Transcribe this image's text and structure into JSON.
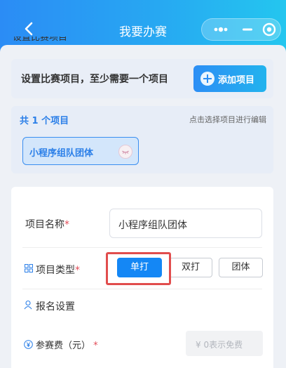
{
  "nav": {
    "title": "我要办赛"
  },
  "peek_text": "设置比赛项目",
  "add_section": {
    "hint": "设置比赛项目，至少需要一个项目",
    "add_button": "添加项目"
  },
  "project_list": {
    "count_label": "共 1 个项目",
    "tip": "点击选择项目进行编辑",
    "items": [
      "小程序组队团体"
    ]
  },
  "form": {
    "name_label": "项目名称",
    "name_value": "小程序组队团体",
    "type_label": "项目类型",
    "type_options": [
      "单打",
      "双打",
      "团体"
    ],
    "type_selected": "单打",
    "signup_label": "报名设置",
    "fee_label": "参赛费（元）",
    "fee_placeholder": "¥ 0表示免费",
    "required_mark": "*"
  },
  "colors": {
    "nav_start": "#2b8cf5",
    "nav_end": "#24c6ef",
    "accent": "#1487f5",
    "required": "#e34d59",
    "highlight": "#e14d4d"
  },
  "icons": [
    "back-arrow-icon",
    "more-dots-icon",
    "minimize-icon",
    "home-target-icon",
    "plus-circle-icon",
    "eye-closed-icon",
    "grid-icon",
    "user-settings-icon",
    "yen-icon"
  ]
}
